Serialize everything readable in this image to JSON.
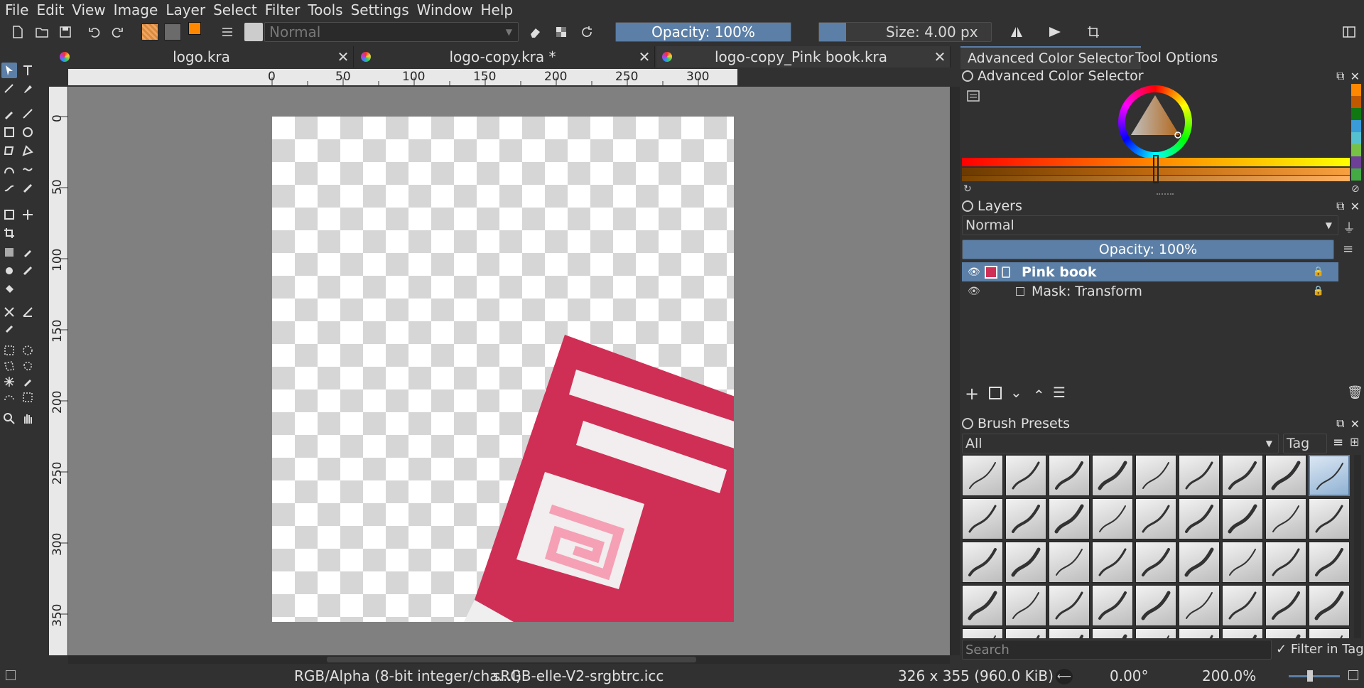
{
  "menu": [
    "File",
    "Edit",
    "View",
    "Image",
    "Layer",
    "Select",
    "Filter",
    "Tools",
    "Settings",
    "Window",
    "Help"
  ],
  "toolbar": {
    "blend_mode": "Normal",
    "opacity": "Opacity: 100%",
    "size": "Size: 4.00 px"
  },
  "tabs": [
    {
      "label": "logo.kra"
    },
    {
      "label": "logo-copy.kra *"
    },
    {
      "label": "logo-copy_Pink book.kra"
    }
  ],
  "ruler_h": [
    "0",
    "50",
    "100",
    "150",
    "200",
    "250",
    "300"
  ],
  "ruler_v": [
    "0",
    "50",
    "100",
    "150",
    "200",
    "250",
    "300",
    "350"
  ],
  "docker_tabs": [
    "Advanced Color Selector",
    "Tool Options"
  ],
  "color_selector": {
    "title": "Advanced Color Selector"
  },
  "layers": {
    "title": "Layers",
    "blend_mode": "Normal",
    "opacity": "Opacity:  100%",
    "items": [
      {
        "name": "Pink book",
        "selected": true
      },
      {
        "name": "Mask: Transform",
        "selected": false
      }
    ]
  },
  "brushes": {
    "title": "Brush Presets",
    "filter": "All",
    "tag_label": "Tag",
    "search_placeholder": "Search",
    "filter_in_tag": "Filter in Tag"
  },
  "status": {
    "color_model": "RGB/Alpha (8-bit integer/cha...l)",
    "profile": "sRGB-elle-V2-srgbtrc.icc",
    "dims": "326 x 355 (960.0 KiB)",
    "rotation": "0.00°",
    "zoom": "200.0%"
  },
  "colors": {
    "accent": "#5b7fa6",
    "book_red": "#cf2f55",
    "book_light": "#f2edee",
    "book_pink": "#f5a0b5",
    "foreground": "#ff8800"
  }
}
